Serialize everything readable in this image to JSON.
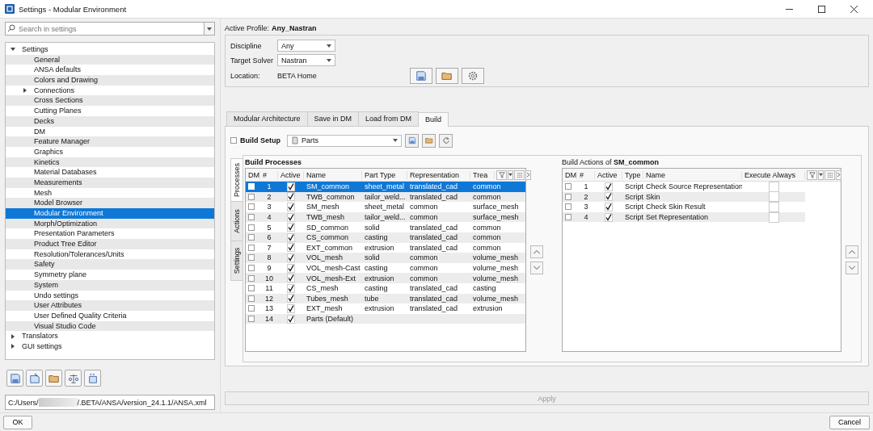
{
  "window": {
    "title": "Settings - Modular Environment"
  },
  "search": {
    "placeholder": "Search in settings"
  },
  "tree": [
    {
      "label": "Settings",
      "expanded": true,
      "selected": false,
      "children": [
        {
          "label": "General",
          "selected": false
        },
        {
          "label": "ANSA defaults",
          "selected": false
        },
        {
          "label": "Colors and Drawing",
          "selected": false
        },
        {
          "label": "Connections",
          "expanded": false,
          "selected": false
        },
        {
          "label": "Cross Sections",
          "selected": false
        },
        {
          "label": "Cutting Planes",
          "selected": false
        },
        {
          "label": "Decks",
          "selected": false
        },
        {
          "label": "DM",
          "selected": false
        },
        {
          "label": "Feature Manager",
          "selected": false
        },
        {
          "label": "Graphics",
          "selected": false
        },
        {
          "label": "Kinetics",
          "selected": false
        },
        {
          "label": "Material Databases",
          "selected": false
        },
        {
          "label": "Measurements",
          "selected": false
        },
        {
          "label": "Mesh",
          "selected": false
        },
        {
          "label": "Model Browser",
          "selected": false
        },
        {
          "label": "Modular Environment",
          "selected": true
        },
        {
          "label": "Morph/Optimization",
          "selected": false
        },
        {
          "label": "Presentation Parameters",
          "selected": false
        },
        {
          "label": "Product Tree Editor",
          "selected": false
        },
        {
          "label": "Resolution/Tolerances/Units",
          "selected": false
        },
        {
          "label": "Safety",
          "selected": false
        },
        {
          "label": "Symmetry plane",
          "selected": false
        },
        {
          "label": "System",
          "selected": false
        },
        {
          "label": "Undo settings",
          "selected": false
        },
        {
          "label": "User Attributes",
          "selected": false
        },
        {
          "label": "User Defined Quality Criteria",
          "selected": false
        },
        {
          "label": "Visual Studio Code",
          "selected": false
        }
      ]
    },
    {
      "label": "Translators",
      "expanded": false,
      "selected": false
    },
    {
      "label": "GUI settings",
      "expanded": false,
      "selected": false
    }
  ],
  "path": {
    "start": "C:/Users/",
    "end": "/.BETA/ANSA/version_24.1.1/ANSA.xml"
  },
  "profile": {
    "label": "Active Profile:",
    "value": "Any_Nastran"
  },
  "fields": [
    {
      "label": "Discipline",
      "value": "Any"
    },
    {
      "label": "Target Solver",
      "value": "Nastran"
    }
  ],
  "location": {
    "label": "Location:",
    "value": "BETA Home"
  },
  "tabs": [
    {
      "label": "Modular Architecture",
      "selected": false
    },
    {
      "label": "Save in DM",
      "selected": false
    },
    {
      "label": "Load from DM",
      "selected": false
    },
    {
      "label": "Build",
      "selected": true
    }
  ],
  "build_setup": {
    "label": "Build Setup",
    "checked": false,
    "value": "Parts"
  },
  "side_tabs": [
    {
      "label": "Processes",
      "selected": true
    },
    {
      "label": "Actions",
      "selected": false
    },
    {
      "label": "Settings",
      "selected": false
    }
  ],
  "processes": {
    "title": "Build Processes",
    "columns": [
      "DM",
      "#",
      "Active",
      "Name",
      "Part Type",
      "Representation",
      "Trea"
    ],
    "rows": [
      {
        "dm": false,
        "n": "1",
        "active": true,
        "name": "SM_common",
        "part_type": "sheet_metal",
        "representation": "translated_cad",
        "treatment": "common",
        "selected": true
      },
      {
        "dm": false,
        "n": "2",
        "active": true,
        "name": "TWB_common",
        "part_type": "tailor_weld...",
        "representation": "translated_cad",
        "treatment": "common",
        "selected": false
      },
      {
        "dm": false,
        "n": "3",
        "active": true,
        "name": "SM_mesh",
        "part_type": "sheet_metal",
        "representation": "common",
        "treatment": "surface_mesh",
        "selected": false
      },
      {
        "dm": false,
        "n": "4",
        "active": true,
        "name": "TWB_mesh",
        "part_type": "tailor_weld...",
        "representation": "common",
        "treatment": "surface_mesh",
        "selected": false
      },
      {
        "dm": false,
        "n": "5",
        "active": true,
        "name": "SD_common",
        "part_type": "solid",
        "representation": "translated_cad",
        "treatment": "common",
        "selected": false
      },
      {
        "dm": false,
        "n": "6",
        "active": true,
        "name": "CS_common",
        "part_type": "casting",
        "representation": "translated_cad",
        "treatment": "common",
        "selected": false
      },
      {
        "dm": false,
        "n": "7",
        "active": true,
        "name": "EXT_common",
        "part_type": "extrusion",
        "representation": "translated_cad",
        "treatment": "common",
        "selected": false
      },
      {
        "dm": false,
        "n": "8",
        "active": true,
        "name": "VOL_mesh",
        "part_type": "solid",
        "representation": "common",
        "treatment": "volume_mesh",
        "selected": false
      },
      {
        "dm": false,
        "n": "9",
        "active": true,
        "name": "VOL_mesh-Cast",
        "part_type": "casting",
        "representation": "common",
        "treatment": "volume_mesh",
        "selected": false
      },
      {
        "dm": false,
        "n": "10",
        "active": true,
        "name": "VOL_mesh-Ext",
        "part_type": "extrusion",
        "representation": "common",
        "treatment": "volume_mesh",
        "selected": false
      },
      {
        "dm": false,
        "n": "11",
        "active": true,
        "name": "CS_mesh",
        "part_type": "casting",
        "representation": "translated_cad",
        "treatment": "casting",
        "selected": false
      },
      {
        "dm": false,
        "n": "12",
        "active": true,
        "name": "Tubes_mesh",
        "part_type": "tube",
        "representation": "translated_cad",
        "treatment": "volume_mesh",
        "selected": false
      },
      {
        "dm": false,
        "n": "13",
        "active": true,
        "name": "EXT_mesh",
        "part_type": "extrusion",
        "representation": "translated_cad",
        "treatment": "extrusion",
        "selected": false
      },
      {
        "dm": false,
        "n": "14",
        "active": true,
        "name": "Parts (Default)",
        "part_type": "",
        "representation": "",
        "treatment": "",
        "selected": false
      }
    ]
  },
  "actions": {
    "title_prefix": "Build Actions of",
    "title_name": "SM_common",
    "columns": [
      "DM",
      "#",
      "Active",
      "Type",
      "Name",
      "Execute Always"
    ],
    "rows": [
      {
        "dm": false,
        "n": "1",
        "active": true,
        "type": "Script",
        "name": "Check Source Representation",
        "execute_always": false
      },
      {
        "dm": false,
        "n": "2",
        "active": true,
        "type": "Script",
        "name": "Skin",
        "execute_always": false
      },
      {
        "dm": false,
        "n": "3",
        "active": true,
        "type": "Script",
        "name": "Check Skin Result",
        "execute_always": false
      },
      {
        "dm": false,
        "n": "4",
        "active": true,
        "type": "Script",
        "name": "Set Representation",
        "execute_always": false
      }
    ]
  },
  "buttons": {
    "apply": "Apply",
    "ok": "OK",
    "cancel": "Cancel"
  }
}
